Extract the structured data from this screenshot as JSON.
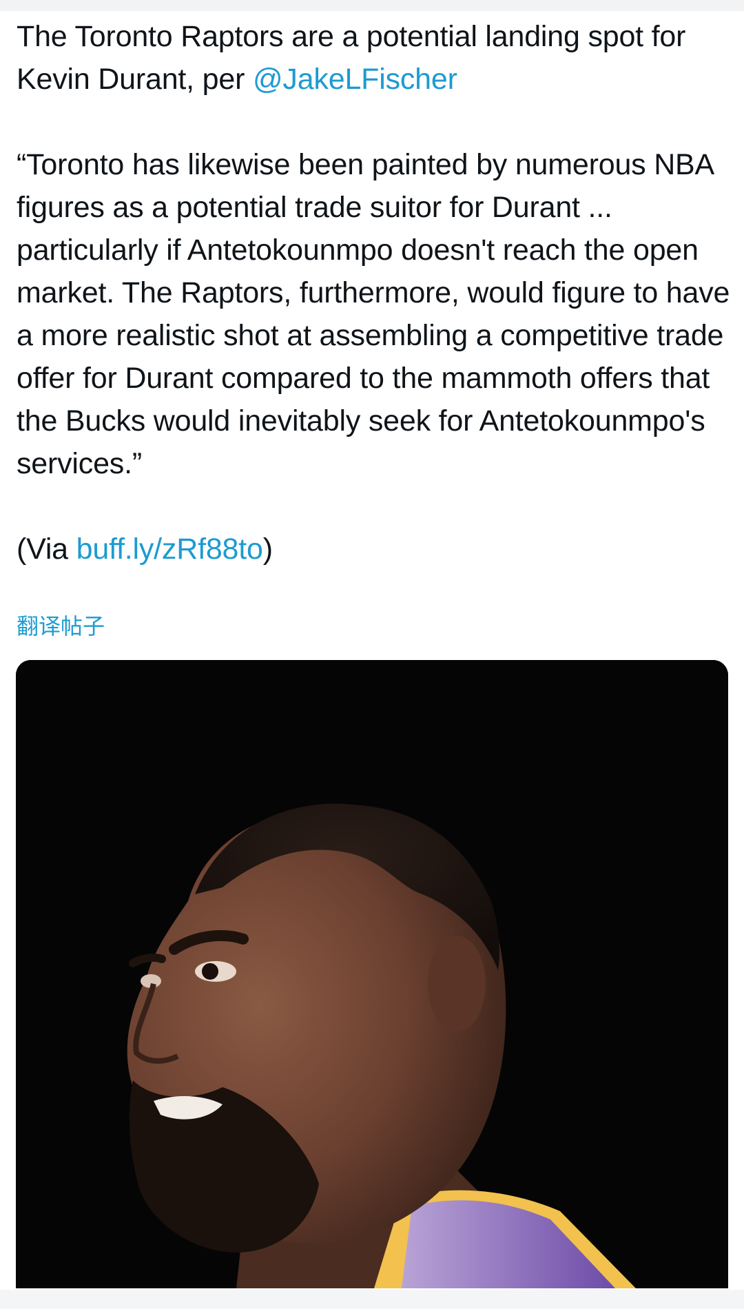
{
  "tweet": {
    "line1_text": "The Toronto Raptors are a potential landing spot for Kevin Durant, per ",
    "line1_mention": "@JakeLFischer",
    "quote": "“Toronto has likewise been painted by numerous NBA figures as a potential trade suitor for Durant ... particularly if Antetokounmpo doesn't reach the open market. The Raptors, furthermore, would figure to have a more realistic shot at assembling a competitive trade offer for Durant compared to the mammoth offers that the Bucks would inevitably seek for Antetokounmpo's services.”",
    "via_prefix": "(Via ",
    "via_link": "buff.ly/zRf88to",
    "via_suffix": ")",
    "translate_label": "翻译帖子"
  },
  "colors": {
    "link": "#1d9bd1",
    "text": "#0f1419",
    "media_background": "#050505"
  },
  "media": {
    "description_icon": "player-photo"
  }
}
